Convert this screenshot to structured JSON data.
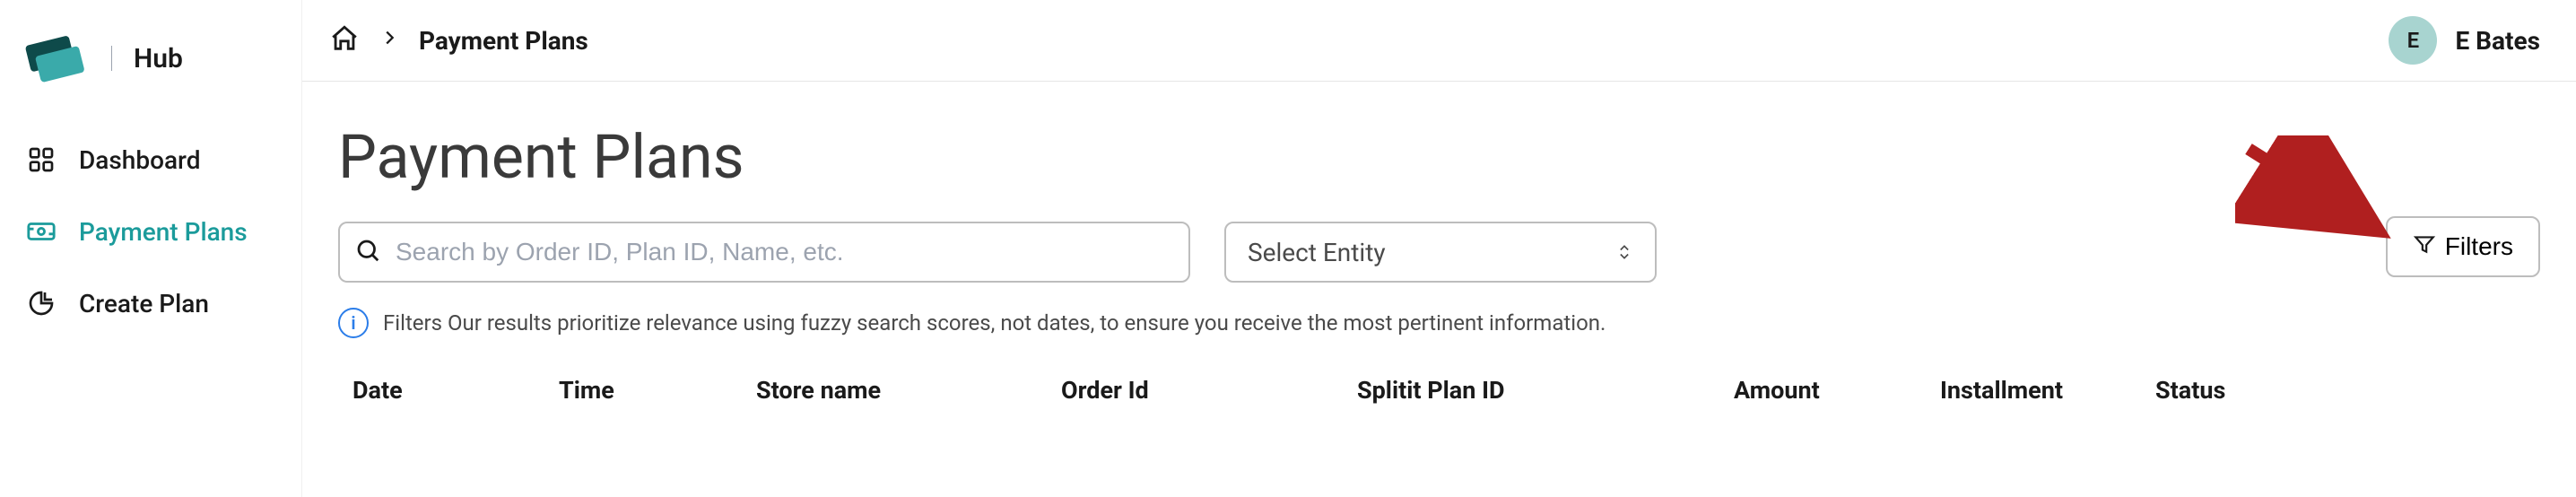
{
  "app": {
    "name": "Hub"
  },
  "sidebar": {
    "items": [
      {
        "label": "Dashboard",
        "active": false
      },
      {
        "label": "Payment Plans",
        "active": true
      },
      {
        "label": "Create Plan",
        "active": false
      }
    ]
  },
  "breadcrumb": {
    "current": "Payment Plans"
  },
  "user": {
    "initial": "E",
    "name": "E Bates"
  },
  "page": {
    "title": "Payment Plans",
    "search_placeholder": "Search by Order ID, Plan ID, Name, etc.",
    "entity_select": "Select Entity",
    "filters_label": "Filters",
    "info_text": "Filters Our results prioritize relevance using fuzzy search scores, not dates, to ensure you receive the most pertinent information."
  },
  "table": {
    "columns": [
      "Date",
      "Time",
      "Store name",
      "Order Id",
      "Splitit Plan ID",
      "Amount",
      "Installment",
      "Status"
    ]
  },
  "colors": {
    "accent": "#1b9b9b",
    "avatar_bg": "#a8d4d0",
    "arrow": "#b01f1f"
  }
}
